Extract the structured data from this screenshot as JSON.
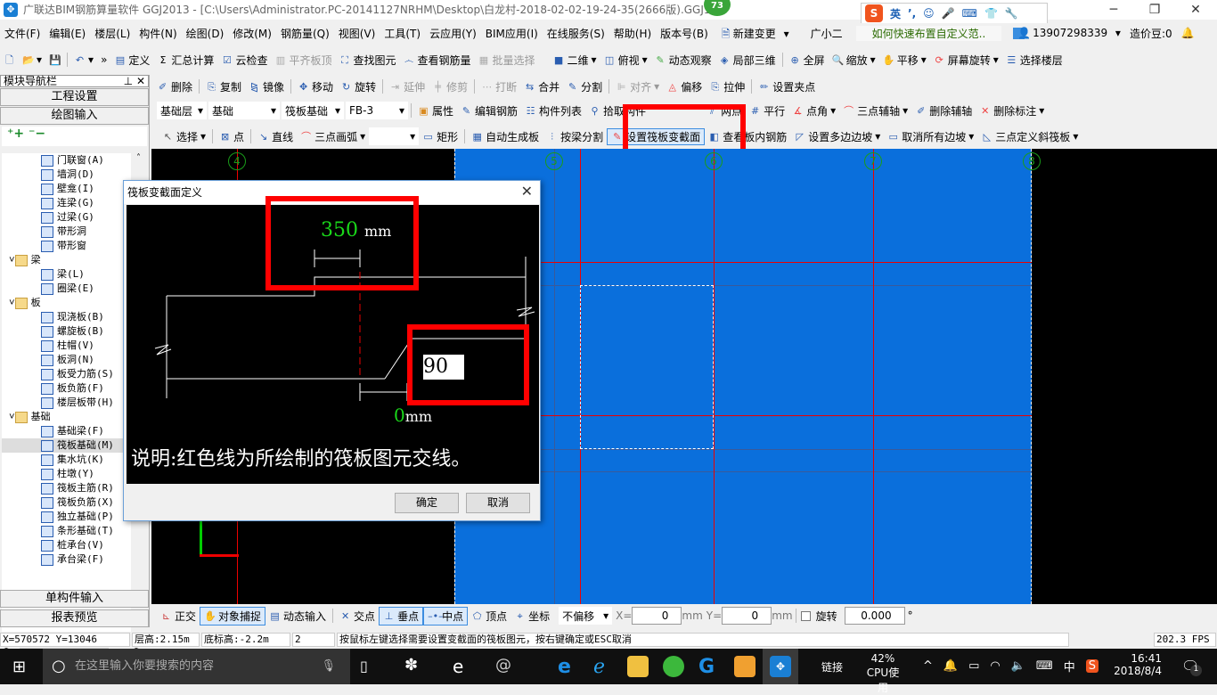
{
  "window": {
    "title": "广联达BIM钢筋算量软件 GGJ2013 - [C:\\Users\\Administrator.PC-20141127NRHM\\Desktop\\白龙村-2018-02-02-19-24-35(2666版).GGJ12]",
    "badge": "73",
    "ime_label": "英"
  },
  "menu": [
    "文件(F)",
    "编辑(E)",
    "楼层(L)",
    "构件(N)",
    "绘图(D)",
    "修改(M)",
    "钢筋量(Q)",
    "视图(V)",
    "工具(T)",
    "云应用(Y)",
    "BIM应用(I)",
    "在线服务(S)",
    "帮助(H)",
    "版本号(B)",
    "新建变更",
    "广小二"
  ],
  "menu_tip": "如何快速布置自定义范..",
  "account": {
    "phone": "13907298339",
    "beans": "造价豆:0"
  },
  "toolbar1": [
    "定义",
    "汇总计算",
    "云检查",
    "平齐板顶",
    "查找图元",
    "查看钢筋量",
    "批量选择",
    "二维",
    "俯视",
    "动态观察",
    "局部三维",
    "全屏",
    "缩放",
    "平移",
    "屏幕旋转",
    "选择楼层"
  ],
  "toolbar2": [
    "删除",
    "复制",
    "镜像",
    "移动",
    "旋转",
    "延伸",
    "修剪",
    "打断",
    "合并",
    "分割",
    "对齐",
    "偏移",
    "拉伸",
    "设置夹点"
  ],
  "toolbar3": {
    "floor": "基础层",
    "category": "基础",
    "type": "筏板基础",
    "element": "FB-3",
    "buttons": [
      "属性",
      "编辑钢筋",
      "构件列表",
      "拾取构件"
    ],
    "axis_buttons": [
      "两点",
      "平行",
      "点角",
      "三点辅轴",
      "删除辅轴",
      "删除标注"
    ]
  },
  "toolbar4": [
    "选择",
    "点",
    "直线",
    "三点画弧",
    "矩形",
    "自动生成板",
    "按梁分割",
    "设置筏板变截面",
    "查看板内钢筋",
    "设置多边边坡",
    "取消所有边坡",
    "三点定义斜筏板"
  ],
  "nav": {
    "title": "模块导航栏",
    "buttons": [
      "工程设置",
      "绘图输入"
    ],
    "bottom_buttons": [
      "单构件输入",
      "报表预览"
    ],
    "tree": [
      {
        "label": "门联窗(A)",
        "level": 2
      },
      {
        "label": "墙洞(D)",
        "level": 2
      },
      {
        "label": "壁龛(I)",
        "level": 2
      },
      {
        "label": "连梁(G)",
        "level": 2
      },
      {
        "label": "过梁(G)",
        "level": 2
      },
      {
        "label": "带形洞",
        "level": 2
      },
      {
        "label": "带形窗",
        "level": 2
      },
      {
        "label": "梁",
        "level": 1
      },
      {
        "label": "梁(L)",
        "level": 2
      },
      {
        "label": "圈梁(E)",
        "level": 2
      },
      {
        "label": "板",
        "level": 1
      },
      {
        "label": "现浇板(B)",
        "level": 2
      },
      {
        "label": "螺旋板(B)",
        "level": 2
      },
      {
        "label": "柱帽(V)",
        "level": 2
      },
      {
        "label": "板洞(N)",
        "level": 2
      },
      {
        "label": "板受力筋(S)",
        "level": 2
      },
      {
        "label": "板负筋(F)",
        "level": 2
      },
      {
        "label": "楼层板带(H)",
        "level": 2
      },
      {
        "label": "基础",
        "level": 1
      },
      {
        "label": "基础梁(F)",
        "level": 2
      },
      {
        "label": "筏板基础(M)",
        "level": 2,
        "selected": true
      },
      {
        "label": "集水坑(K)",
        "level": 2
      },
      {
        "label": "柱墩(Y)",
        "level": 2
      },
      {
        "label": "筏板主筋(R)",
        "level": 2
      },
      {
        "label": "筏板负筋(X)",
        "level": 2
      },
      {
        "label": "独立基础(P)",
        "level": 2
      },
      {
        "label": "条形基础(T)",
        "level": 2
      },
      {
        "label": "桩承台(V)",
        "level": 2
      },
      {
        "label": "承台梁(F)",
        "level": 2
      }
    ]
  },
  "canvas": {
    "axes": [
      "4",
      "5",
      "6",
      "7",
      "8"
    ],
    "colors": {
      "slab": "#0a6fdc",
      "grid": "#e00000",
      "background": "#000000"
    }
  },
  "dialog": {
    "title": "筏板变截面定义",
    "width_value": "350",
    "width_unit": "mm",
    "angle_value": "90",
    "offset_value": "0",
    "offset_unit": "mm",
    "note": "说明:红色线为所绘制的筏板图元交线。",
    "ok": "确定",
    "cancel": "取消"
  },
  "snapbar": {
    "buttons": [
      "正交",
      "对象捕捉",
      "动态输入",
      "交点",
      "垂点",
      "中点",
      "顶点",
      "坐标"
    ],
    "offset_mode": "不偏移",
    "x_label": "X=",
    "x_value": "0",
    "y_label": "Y=",
    "y_value": "0",
    "unit": "mm",
    "rotate_label": "旋转",
    "rotate_value": "0.000",
    "degree": "°"
  },
  "status": {
    "coords": "X=570572 Y=13046",
    "floor_height": "层高:2.15m",
    "bottom_elev": "底标高:-2.2m",
    "num": "2",
    "hint": "按鼠标左键选择需要设置变截面的筏板图元，按右键确定或ESC取消",
    "fps": "202.3 FPS"
  },
  "taskbar": {
    "search_placeholder": "在这里输入你要搜索的内容",
    "link": "链接",
    "cpu_pct": "42%",
    "cpu_label": "CPU使用",
    "lang": "中",
    "time": "16:41",
    "date": "2018/8/4",
    "notif": "1"
  }
}
